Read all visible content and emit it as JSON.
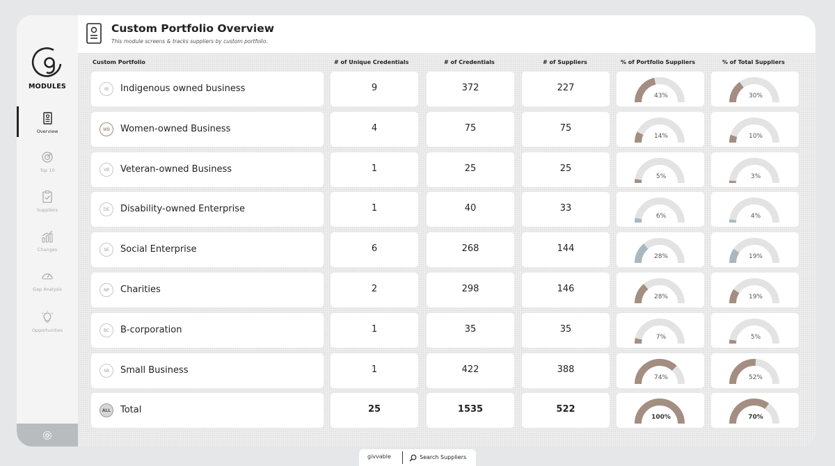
{
  "header": {
    "title": "Custom Portfolio Overview",
    "subtitle": "This module screens & tracks suppliers by custom portfolio."
  },
  "sidebar": {
    "modules_label": "MODULES",
    "items": [
      {
        "label": "Overview",
        "icon": "document-icon",
        "active": true
      },
      {
        "label": "Top 10",
        "icon": "target-icon",
        "active": false
      },
      {
        "label": "Suppliers",
        "icon": "clipboard-check-icon",
        "active": false
      },
      {
        "label": "Changes",
        "icon": "bar-chart-icon",
        "active": false
      },
      {
        "label": "Gap Analysis",
        "icon": "gauge-icon",
        "active": false
      },
      {
        "label": "Opportunities",
        "icon": "lightbulb-icon",
        "active": false
      }
    ],
    "settings_icon": "gear-icon"
  },
  "table": {
    "columns": [
      "Custom Portfolio",
      "# of Unique  Credentials",
      "# of Credentials",
      "# of Suppliers",
      "% of Portfolio Suppliers",
      "% of Total Suppliers"
    ],
    "rows": [
      {
        "badge": "IB",
        "name": "Indigenous owned business",
        "unique": "9",
        "credentials": "372",
        "suppliers": "227",
        "pct_portfolio": 43,
        "pct_portfolio_label": "43%",
        "pct_total": 30,
        "pct_total_label": "30%",
        "color": "#a38e81",
        "badge_style": "plain"
      },
      {
        "badge": "WB",
        "name": "Women-owned Business",
        "unique": "4",
        "credentials": "75",
        "suppliers": "75",
        "pct_portfolio": 14,
        "pct_portfolio_label": "14%",
        "pct_total": 10,
        "pct_total_label": "10%",
        "color": "#a38e81",
        "badge_style": "brown"
      },
      {
        "badge": "VB",
        "name": "Veteran-owned Business",
        "unique": "1",
        "credentials": "25",
        "suppliers": "25",
        "pct_portfolio": 5,
        "pct_portfolio_label": "5%",
        "pct_total": 3,
        "pct_total_label": "3%",
        "color": "#a38e81",
        "badge_style": "plain"
      },
      {
        "badge": "DE",
        "name": "Disability-owned Enterprise",
        "unique": "1",
        "credentials": "40",
        "suppliers": "33",
        "pct_portfolio": 6,
        "pct_portfolio_label": "6%",
        "pct_total": 4,
        "pct_total_label": "4%",
        "color": "#a9b8c0",
        "badge_style": "plain"
      },
      {
        "badge": "SE",
        "name": "Social Enterprise",
        "unique": "6",
        "credentials": "268",
        "suppliers": "144",
        "pct_portfolio": 28,
        "pct_portfolio_label": "28%",
        "pct_total": 19,
        "pct_total_label": "19%",
        "color": "#a9b8c0",
        "badge_style": "plain"
      },
      {
        "badge": "NP",
        "name": "Charities",
        "unique": "2",
        "credentials": "298",
        "suppliers": "146",
        "pct_portfolio": 28,
        "pct_portfolio_label": "28%",
        "pct_total": 19,
        "pct_total_label": "19%",
        "color": "#a38e81",
        "badge_style": "plain"
      },
      {
        "badge": "BC",
        "name": "B-corporation",
        "unique": "1",
        "credentials": "35",
        "suppliers": "35",
        "pct_portfolio": 7,
        "pct_portfolio_label": "7%",
        "pct_total": 5,
        "pct_total_label": "5%",
        "color": "#a38e81",
        "badge_style": "plain"
      },
      {
        "badge": "SB",
        "name": "Small Business",
        "unique": "1",
        "credentials": "422",
        "suppliers": "388",
        "pct_portfolio": 74,
        "pct_portfolio_label": "74%",
        "pct_total": 52,
        "pct_total_label": "52%",
        "color": "#a38e81",
        "badge_style": "plain"
      }
    ],
    "total": {
      "badge": "ALL",
      "name": "Total",
      "unique": "25",
      "credentials": "1535",
      "suppliers": "522",
      "pct_portfolio": 100,
      "pct_portfolio_label": "100%",
      "pct_total": 70,
      "pct_total_label": "70%",
      "color": "#a38e81",
      "badge_style": "all"
    }
  },
  "footer": {
    "brand": "givvable",
    "search_label": "Search Suppliers",
    "search_icon": "search-icon"
  },
  "colors": {
    "gauge_track": "#e3e3e3",
    "brown": "#a38e81",
    "blue_grey": "#a9b8c0"
  }
}
